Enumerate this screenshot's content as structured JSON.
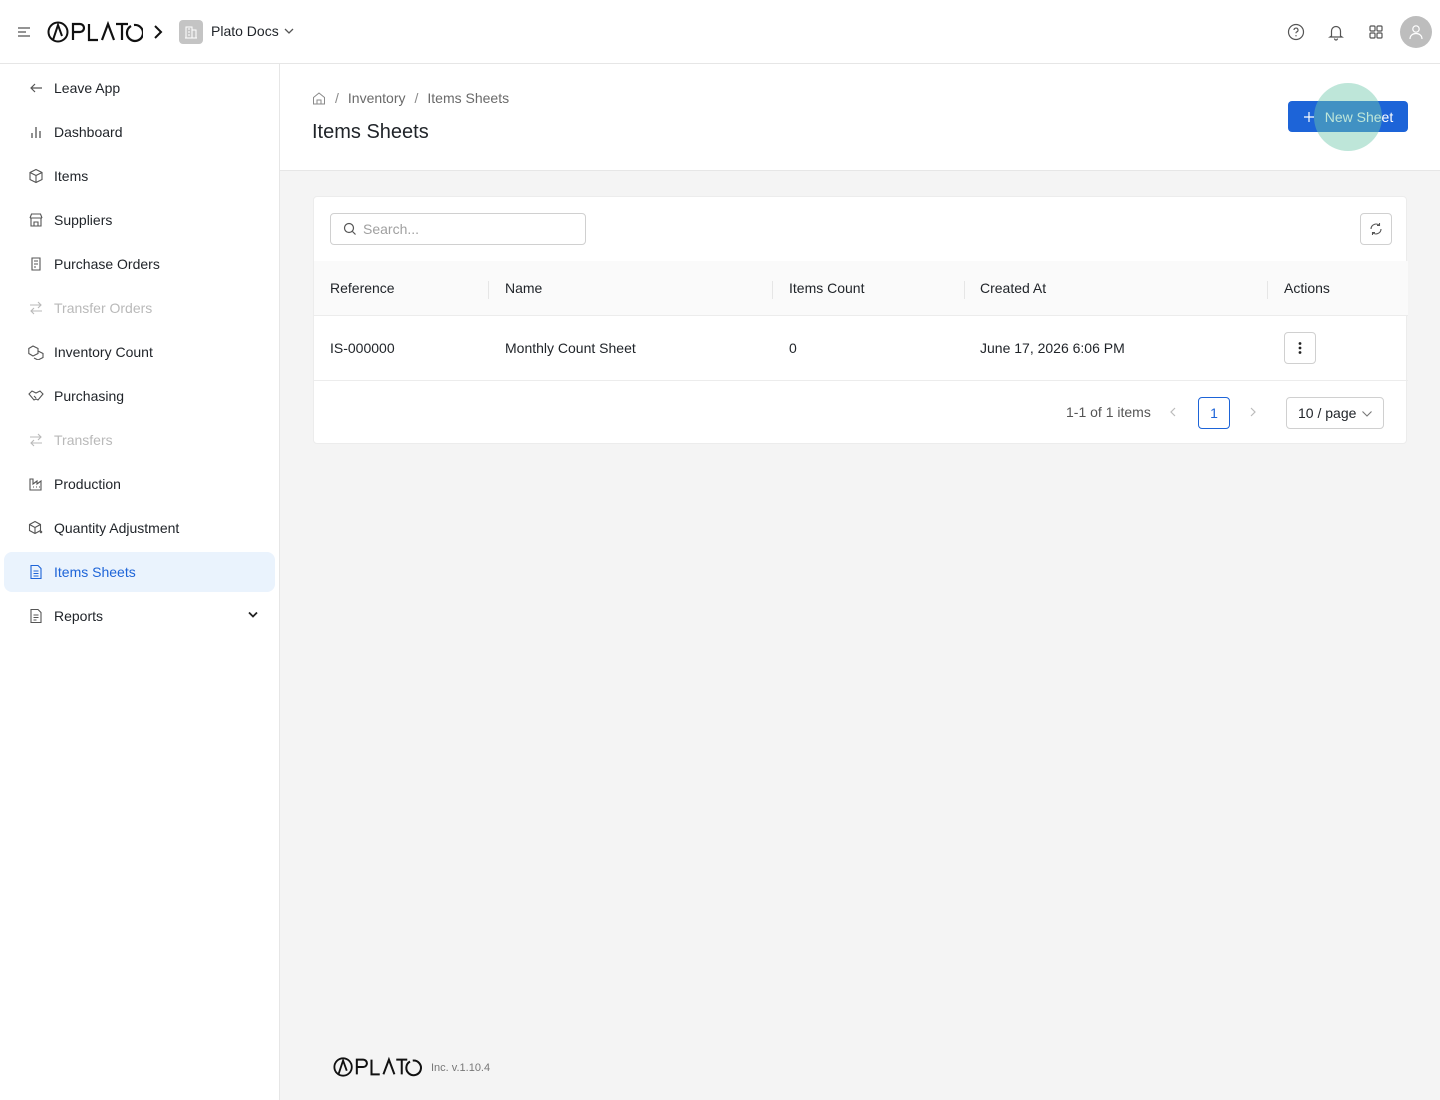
{
  "topbar": {
    "org_name": "Plato Docs",
    "icons": [
      "menu-icon",
      "help-icon",
      "bell-icon",
      "apps-grid-icon",
      "user-avatar-icon"
    ]
  },
  "sidebar": {
    "items": [
      {
        "label": "Leave App",
        "icon": "arrow-left-icon",
        "state": "normal"
      },
      {
        "label": "Dashboard",
        "icon": "bar-chart-icon",
        "state": "normal"
      },
      {
        "label": "Items",
        "icon": "box-icon",
        "state": "normal"
      },
      {
        "label": "Suppliers",
        "icon": "store-icon",
        "state": "normal"
      },
      {
        "label": "Purchase Orders",
        "icon": "clipboard-icon",
        "state": "normal"
      },
      {
        "label": "Transfer Orders",
        "icon": "transfer-icon",
        "state": "disabled"
      },
      {
        "label": "Inventory Count",
        "icon": "boxes-icon",
        "state": "normal"
      },
      {
        "label": "Purchasing",
        "icon": "handshake-icon",
        "state": "normal"
      },
      {
        "label": "Transfers",
        "icon": "transfer-icon",
        "state": "disabled"
      },
      {
        "label": "Production",
        "icon": "factory-icon",
        "state": "normal"
      },
      {
        "label": "Quantity Adjustment",
        "icon": "box-adjust-icon",
        "state": "normal"
      },
      {
        "label": "Items Sheets",
        "icon": "sheet-icon",
        "state": "active"
      },
      {
        "label": "Reports",
        "icon": "report-icon",
        "state": "normal"
      }
    ]
  },
  "header": {
    "breadcrumb": [
      "Inventory",
      "Items Sheets"
    ],
    "title": "Items Sheets",
    "new_button": "New Sheet"
  },
  "table": {
    "search_placeholder": "Search...",
    "columns": [
      "Reference",
      "Name",
      "Items Count",
      "Created At",
      "Actions"
    ],
    "rows": [
      {
        "reference": "IS-000000",
        "name": "Monthly Count Sheet",
        "items_count": "0",
        "created_at": "June 17, 2026 6:06 PM"
      }
    ],
    "pagination": {
      "total": "1-1 of 1 items",
      "current_page": "1",
      "page_size": "10 / page"
    }
  },
  "footer": {
    "version": "Inc. v.1.10.4"
  },
  "colors": {
    "accent": "#1d64d8",
    "active_bg": "#eaf3fd"
  }
}
